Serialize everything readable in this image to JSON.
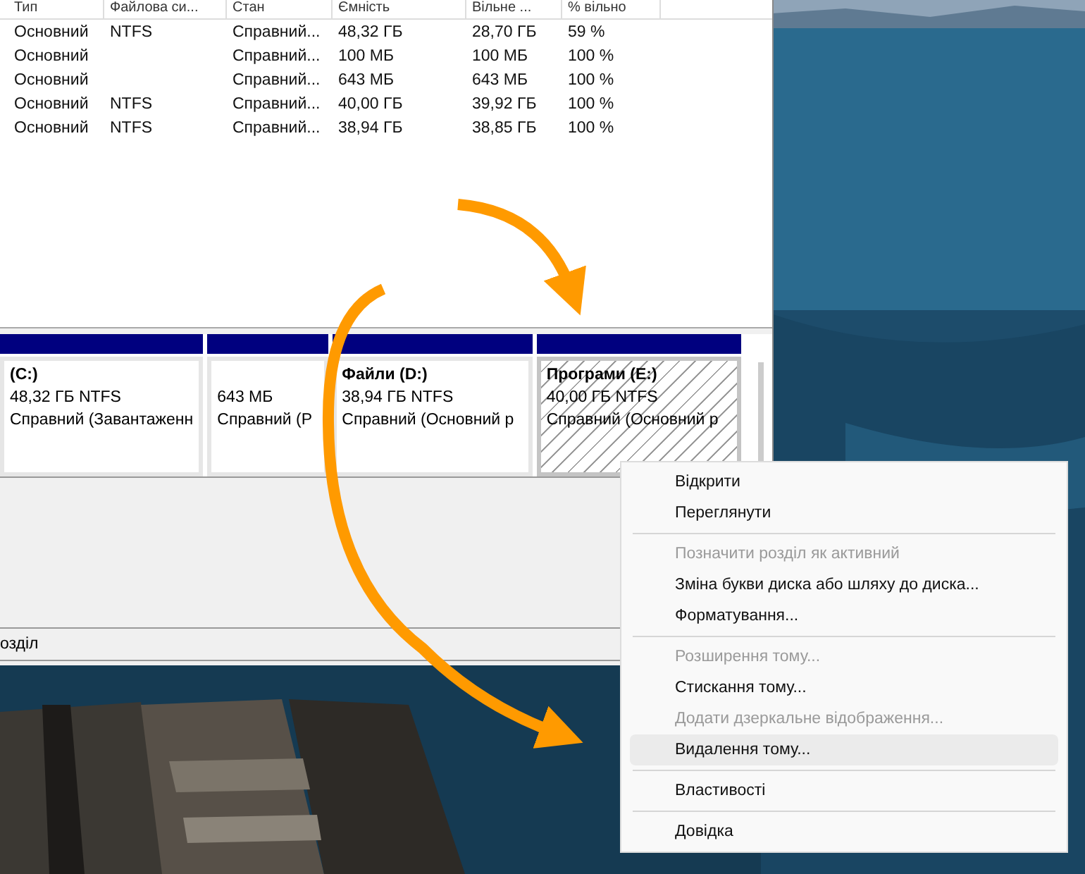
{
  "table": {
    "columns": [
      "Тип",
      "Файлова си...",
      "Стан",
      "Ємність",
      "Вільне ...",
      "% вільно"
    ],
    "rows": [
      [
        "Основний",
        "NTFS",
        "Справний...",
        "48,32 ГБ",
        "28,70 ГБ",
        "59 %"
      ],
      [
        "Основний",
        "",
        "Справний...",
        "100 МБ",
        "100 МБ",
        "100 %"
      ],
      [
        "Основний",
        "",
        "Справний...",
        "643 МБ",
        "643 МБ",
        "100 %"
      ],
      [
        "Основний",
        "NTFS",
        "Справний...",
        "40,00 ГБ",
        "39,92 ГБ",
        "100 %"
      ],
      [
        "Основний",
        "NTFS",
        "Справний...",
        "38,94 ГБ",
        "38,85 ГБ",
        "100 %"
      ]
    ]
  },
  "partitions": [
    {
      "name": "(C:)",
      "size": "48,32 ГБ NTFS",
      "status": "Справний (Завантаженн",
      "selected": false
    },
    {
      "size": "643 МБ",
      "status": "Справний (Р",
      "selected": false
    },
    {
      "name": "Файли  (D:)",
      "size": "38,94 ГБ NTFS",
      "status": "Справний (Основний р",
      "selected": false
    },
    {
      "name": "Програми  (E:)",
      "size": "40,00 ГБ NTFS",
      "status": "Справний (Основний р",
      "selected": true
    }
  ],
  "legend": "озділ",
  "context_menu": [
    {
      "kind": "item",
      "label": "Відкрити",
      "disabled": false,
      "selected": false
    },
    {
      "kind": "item",
      "label": "Переглянути",
      "disabled": false,
      "selected": false
    },
    {
      "kind": "separator"
    },
    {
      "kind": "item",
      "label": "Позначити розділ як активний",
      "disabled": true,
      "selected": false
    },
    {
      "kind": "item",
      "label": "Зміна букви диска або шляху до диска...",
      "disabled": false,
      "selected": false
    },
    {
      "kind": "item",
      "label": "Форматування...",
      "disabled": false,
      "selected": false
    },
    {
      "kind": "separator"
    },
    {
      "kind": "item",
      "label": "Розширення тому...",
      "disabled": true,
      "selected": false
    },
    {
      "kind": "item",
      "label": "Стискання тому...",
      "disabled": false,
      "selected": false
    },
    {
      "kind": "item",
      "label": "Додати дзеркальне відображення...",
      "disabled": true,
      "selected": false
    },
    {
      "kind": "item",
      "label": "Видалення тому...",
      "disabled": false,
      "selected": true
    },
    {
      "kind": "separator"
    },
    {
      "kind": "item",
      "label": "Властивості",
      "disabled": false,
      "selected": false
    },
    {
      "kind": "separator"
    },
    {
      "kind": "item",
      "label": "Довідка",
      "disabled": false,
      "selected": false
    }
  ]
}
